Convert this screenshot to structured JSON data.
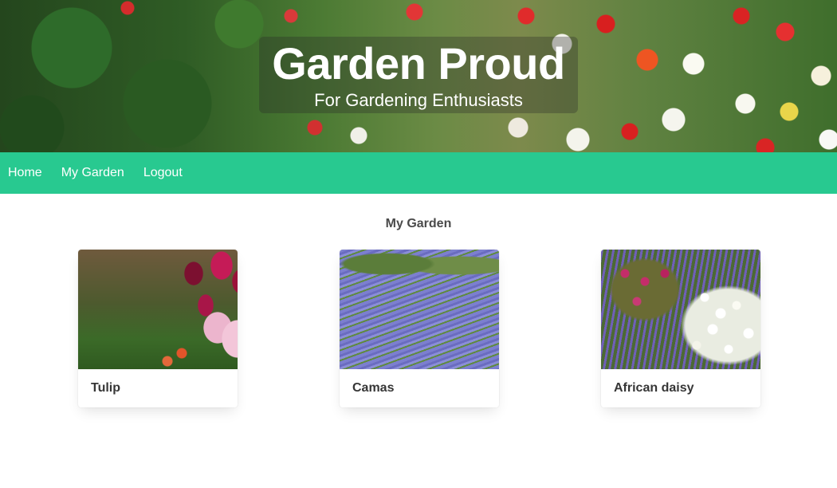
{
  "header": {
    "title": "Garden Proud",
    "subtitle": "For Gardening Enthusiasts"
  },
  "nav": {
    "items": [
      {
        "label": "Home"
      },
      {
        "label": "My Garden"
      },
      {
        "label": "Logout"
      }
    ],
    "color": "#28c990"
  },
  "main": {
    "title": "My Garden",
    "cards": [
      {
        "name": "Tulip"
      },
      {
        "name": "Camas"
      },
      {
        "name": "African daisy"
      }
    ]
  }
}
